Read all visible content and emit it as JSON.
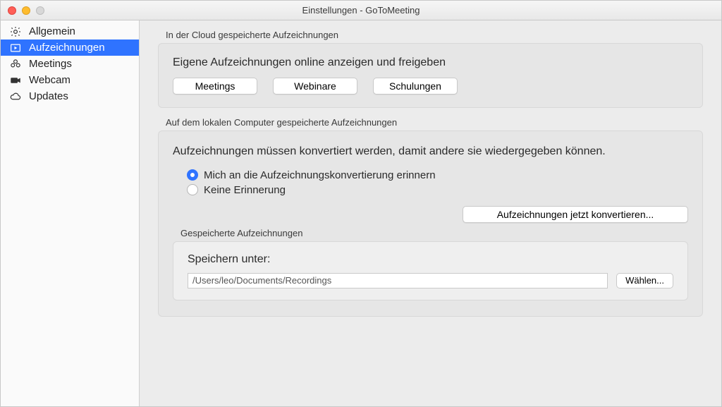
{
  "window": {
    "title": "Einstellungen - GoToMeeting"
  },
  "sidebar": {
    "items": [
      {
        "label": "Allgemein",
        "icon": "gear",
        "selected": false
      },
      {
        "label": "Aufzeichnungen",
        "icon": "record",
        "selected": true
      },
      {
        "label": "Meetings",
        "icon": "flower",
        "selected": false
      },
      {
        "label": "Webcam",
        "icon": "camera",
        "selected": false
      },
      {
        "label": "Updates",
        "icon": "cloud",
        "selected": false
      }
    ]
  },
  "cloud_group": {
    "label": "In der Cloud gespeicherte Aufzeichnungen",
    "heading": "Eigene Aufzeichnungen online anzeigen und freigeben",
    "buttons": {
      "meetings": "Meetings",
      "webinare": "Webinare",
      "schulungen": "Schulungen"
    }
  },
  "local_group": {
    "label": "Auf dem lokalen Computer gespeicherte Aufzeichnungen",
    "bodytext": "Aufzeichnungen müssen konvertiert werden, damit andere sie wiedergegeben können.",
    "radios": {
      "remind": "Mich an die Aufzeichnungskonvertierung erinnern",
      "no_remind": "Keine Erinnerung",
      "selected": "remind"
    },
    "convert_button": "Aufzeichnungen jetzt konvertieren...",
    "saved_subgroup": {
      "label": "Gespeicherte Aufzeichnungen",
      "save_label": "Speichern unter:",
      "path": "/Users/leo/Documents/Recordings",
      "choose_button": "Wählen..."
    }
  }
}
